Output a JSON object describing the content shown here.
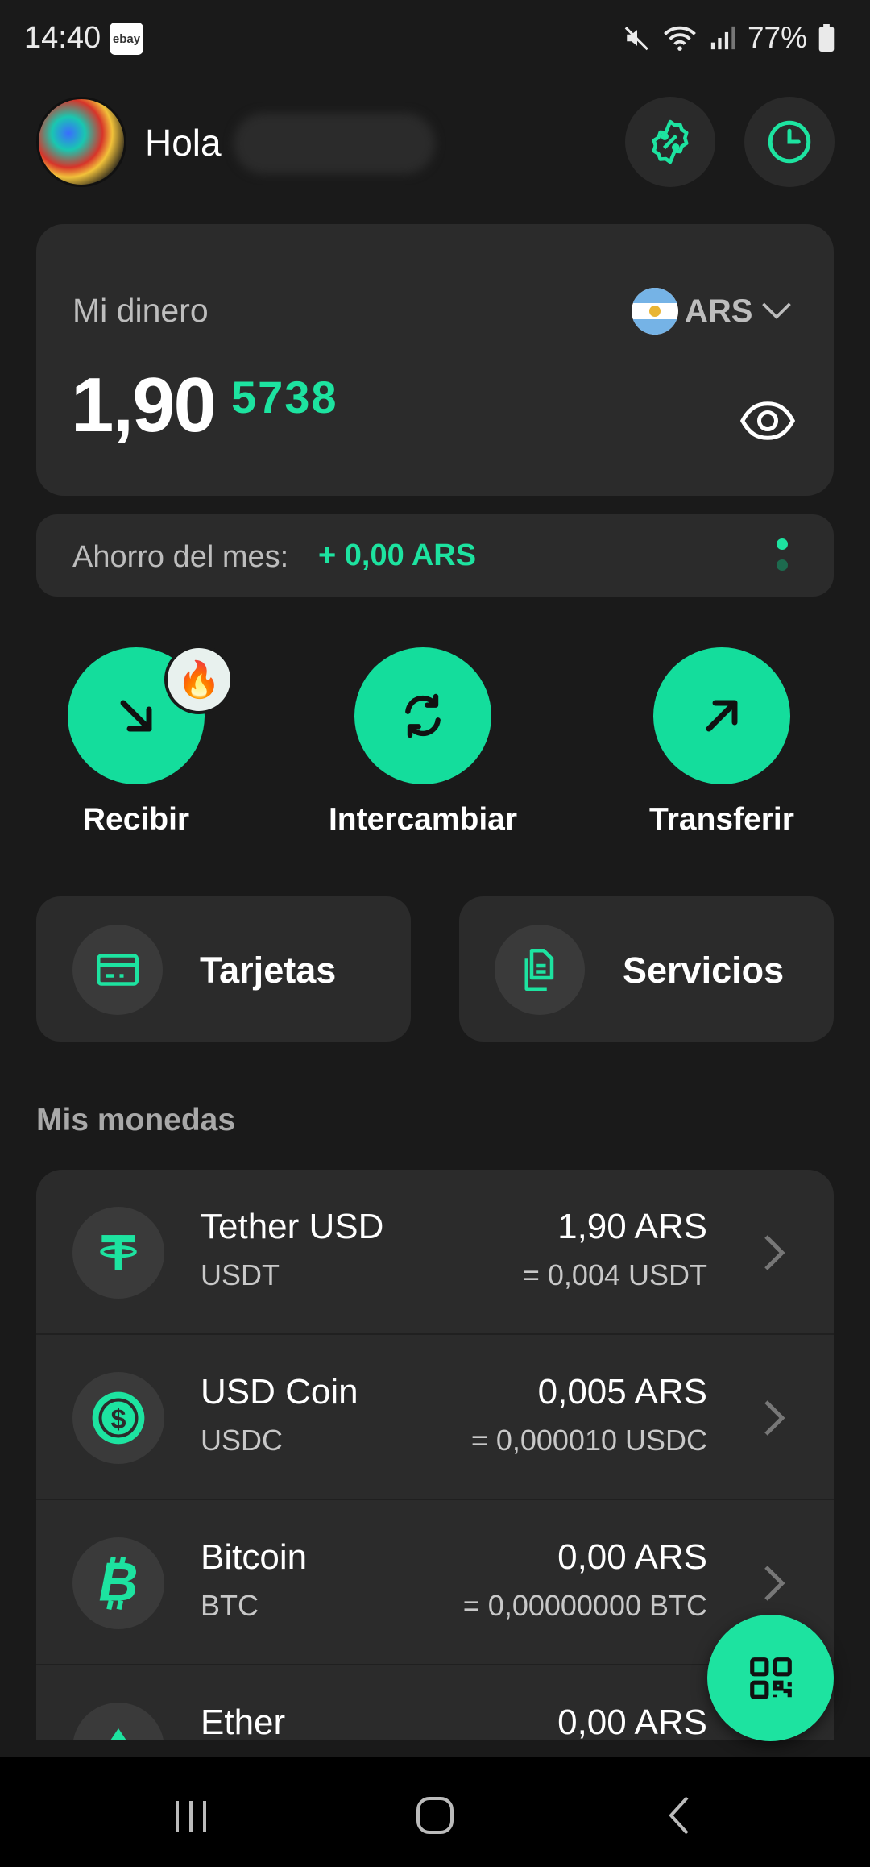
{
  "status_bar": {
    "time": "14:40",
    "app_badge": "ebay",
    "battery": "77%"
  },
  "header": {
    "greeting": "Hola",
    "icons": [
      "discount-badge-icon",
      "history-clock-icon"
    ]
  },
  "balance_card": {
    "label": "Mi dinero",
    "currency": "ARS",
    "amount_integer": "1,90",
    "amount_decimals": "5738"
  },
  "savings": {
    "label": "Ahorro del mes:",
    "value": "+ 0,00 ARS"
  },
  "actions": [
    {
      "label": "Recibir",
      "icon": "arrow-down-right-icon",
      "badge": "fire-icon"
    },
    {
      "label": "Intercambiar",
      "icon": "swap-icon"
    },
    {
      "label": "Transferir",
      "icon": "arrow-up-right-icon"
    }
  ],
  "tiles": [
    {
      "label": "Tarjetas",
      "icon": "card-icon"
    },
    {
      "label": "Servicios",
      "icon": "documents-icon"
    }
  ],
  "coins": {
    "title": "Mis monedas",
    "items": [
      {
        "name": "Tether USD",
        "symbol": "USDT",
        "amount": "1,90 ARS",
        "conversion": "= 0,004 USDT"
      },
      {
        "name": "USD Coin",
        "symbol": "USDC",
        "amount": "0,005 ARS",
        "conversion": "= 0,000010 USDC"
      },
      {
        "name": "Bitcoin",
        "symbol": "BTC",
        "amount": "0,00 ARS",
        "conversion": "= 0,00000000 BTC"
      },
      {
        "name": "Ether",
        "symbol": "",
        "amount": "0,00 ARS",
        "conversion": ""
      }
    ]
  },
  "colors": {
    "accent": "#1de3a0",
    "background": "#1a1a1a",
    "card": "#2b2b2b"
  }
}
